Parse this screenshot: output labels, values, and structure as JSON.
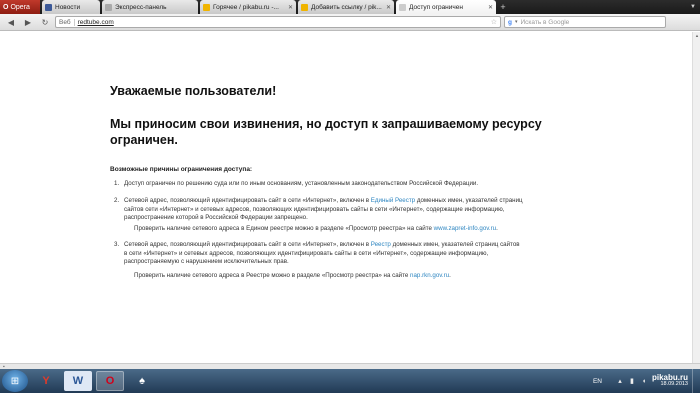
{
  "browser": {
    "menu_label": "Opera",
    "tabs": [
      {
        "label": "Новости",
        "color": "#3b5998"
      },
      {
        "label": "Экспресс-панель",
        "color": "#aaaaaa"
      },
      {
        "label": "Горячее / pikabu.ru -...",
        "color": "#f0b400"
      },
      {
        "label": "Добавить ссылку / pik...",
        "color": "#f0b400"
      },
      {
        "label": "Доступ ограничен",
        "color": "#cccccc"
      }
    ],
    "tab_close": "✕",
    "add_tab": "+",
    "address": {
      "badge": "Веб",
      "url": "redtube.com"
    },
    "search_placeholder": "Искать в Google"
  },
  "page": {
    "greeting": "Уважаемые пользователи!",
    "apology": "Мы приносим свои извинения, но доступ к запрашиваемому ресурсу ограничен.",
    "reasons_title": "Возможные причины ограничения доступа:",
    "reason1": {
      "num": "1.",
      "text": "Доступ ограничен  по решению суда или по иным основаниям, установленным законодательством Российской Федерации."
    },
    "reason2": {
      "num": "2.",
      "before": "Сетевой адрес, позволяющий идентифицировать сайт в сети «Интернет», включен в ",
      "link": "Единый Реестр",
      "after": " доменных имен, указателей страниц сайтов сети «Интернет» и сетевых адресов, позволяющих идентифицировать сайты в сети «Интернет», содержащие информацию, распространение которой в Российской Федерации запрещено.",
      "check_before": "Проверить наличие сетевого адреса в Едином реестре можно в разделе «Просмотр реестра» на сайте ",
      "check_link": "www.zapret-info.gov.ru",
      "check_after": "."
    },
    "reason3": {
      "num": "3.",
      "before": "Сетевой адрес, позволяющий идентифицировать сайт в сети «Интернет», включен в ",
      "link": "Реестр",
      "after": " доменных имен, указателей страниц сайтов в сети «Интернет» и сетевых адресов, позволяющих идентифицировать сайты в сети «Интернет», содержащие информацию, распространяемую с нарушением исключительных прав.",
      "check_before": "Проверить наличие сетевого адреса в Реестре можно в разделе «Просмотр реестра» на сайте ",
      "check_link": "nap.rkn.gov.ru",
      "check_after": "."
    }
  },
  "taskbar": {
    "apps": [
      {
        "name": "yandex",
        "glyph": "Y",
        "color": "#e03a2a"
      },
      {
        "name": "word",
        "glyph": "W",
        "color": "#2b5797"
      },
      {
        "name": "opera",
        "glyph": "O",
        "color": "#d0021b"
      },
      {
        "name": "solitaire",
        "glyph": "♠",
        "color": "#ffffff"
      }
    ],
    "lang": "EN",
    "watermark": "pikabu.ru",
    "time": "18.09.2013"
  }
}
